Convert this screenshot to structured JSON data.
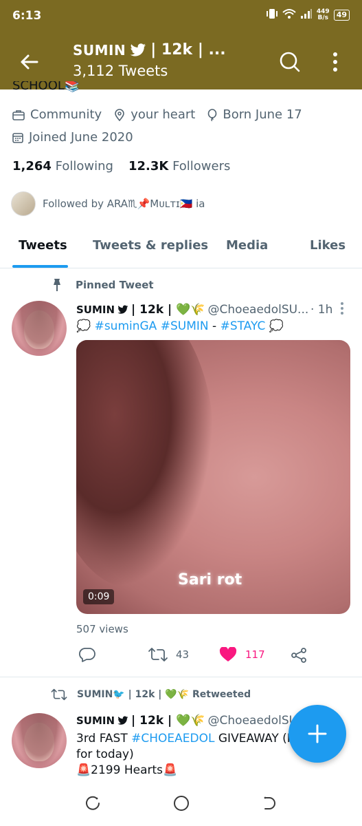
{
  "status_bar": {
    "time": "6:13",
    "net_speed_value": "449",
    "net_speed_unit": "B/s",
    "battery": "49"
  },
  "app_bar": {
    "title_name": "SUMIN",
    "title_rest": "| 12k | ...",
    "subtitle": "3,112 Tweets"
  },
  "profile": {
    "bio_tail": "SCHOOL📚",
    "category": "Community",
    "location": "your heart",
    "birthday": "Born June 17",
    "joined": "Joined June 2020",
    "following_count": "1,264",
    "following_label": "Following",
    "followers_count": "12.3K",
    "followers_label": "Followers",
    "followed_by": "Followed by ARA♏📌Mᴜʟᴛɪ🇵🇭 ia"
  },
  "tabs": [
    {
      "label": "Tweets"
    },
    {
      "label": "Tweets & replies"
    },
    {
      "label": "Media"
    },
    {
      "label": "Likes"
    }
  ],
  "pinned_tweet": {
    "pinned_label": "Pinned Tweet",
    "name": "SUMIN",
    "name_suffix": "| 12k | 💚🌾",
    "handle": "@ChoeaedolSU...",
    "time": "· 1h",
    "text_prefix": "💭 ",
    "hashtag1": "#suminGA",
    "hashtag2": "#SUMIN",
    "separator": " - ",
    "hashtag3": "#STAYC",
    "text_suffix": " 💭",
    "media_caption": "Sari rot",
    "media_duration": "0:09",
    "views": "507 views",
    "retweets": "43",
    "likes": "117"
  },
  "retweet": {
    "retweeted_by": "SUMIN🐦 | 12k | 💚🌾 Retweeted",
    "name": "SUMIN",
    "name_suffix": "| 12k | 💚🌾",
    "handle": "@ChoeaedolSU...",
    "line1_prefix": "3rd FAST ",
    "line1_hashtag": "#CHOEAEDOL",
    "line1_suffix": " GIVEAWAY (I",
    "line2": "for today)",
    "line3": "🚨2199 Hearts🚨"
  },
  "colors": {
    "header_bg": "#7b6a22",
    "accent": "#1d9bf0",
    "like": "#f91880",
    "muted_text": "#536471"
  },
  "icons": [
    "back-arrow-icon",
    "search-icon",
    "more-vertical-icon",
    "briefcase-icon",
    "location-pin-icon",
    "balloon-icon",
    "calendar-icon",
    "pin-icon",
    "reply-icon",
    "retweet-icon",
    "heart-icon",
    "share-icon",
    "compose-plus-icon"
  ]
}
